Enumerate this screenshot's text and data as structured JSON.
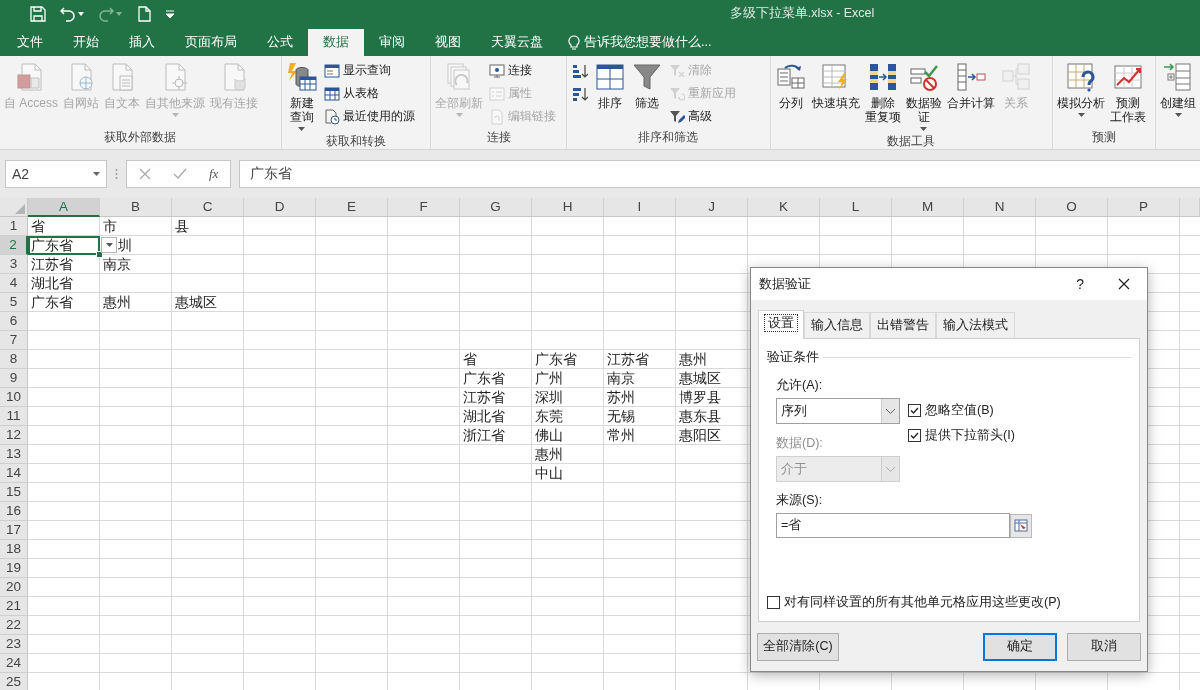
{
  "window": {
    "title": "多级下拉菜单.xlsx - Excel"
  },
  "ribbon_tabs": [
    {
      "label": "文件",
      "selected": false
    },
    {
      "label": "开始",
      "selected": false
    },
    {
      "label": "插入",
      "selected": false
    },
    {
      "label": "页面布局",
      "selected": false
    },
    {
      "label": "公式",
      "selected": false
    },
    {
      "label": "数据",
      "selected": true
    },
    {
      "label": "审阅",
      "selected": false
    },
    {
      "label": "视图",
      "selected": false
    },
    {
      "label": "天翼云盘",
      "selected": false
    }
  ],
  "tell_me": {
    "text": "告诉我您想要做什么..."
  },
  "ribbon": {
    "groups": [
      {
        "label": "获取外部数据",
        "controls": [
          {
            "kind": "large",
            "lines": [
              "自 Access"
            ],
            "disabled": true,
            "caret": false
          },
          {
            "kind": "large",
            "lines": [
              "自网站"
            ],
            "disabled": true,
            "caret": false
          },
          {
            "kind": "large",
            "lines": [
              "自文本"
            ],
            "disabled": true,
            "caret": false
          },
          {
            "kind": "large",
            "lines": [
              "自其他来源"
            ],
            "disabled": true,
            "caret": true
          },
          {
            "kind": "large",
            "lines": [
              "现有连接"
            ],
            "disabled": true,
            "caret": false
          }
        ]
      },
      {
        "label": "获取和转换",
        "controls": [
          {
            "kind": "large",
            "lines": [
              "新建",
              "查询"
            ],
            "disabled": false,
            "caret": true
          },
          {
            "kind": "stack",
            "items": [
              {
                "label": "显示查询",
                "disabled": false
              },
              {
                "label": "从表格",
                "disabled": false
              },
              {
                "label": "最近使用的源",
                "disabled": false
              }
            ]
          }
        ]
      },
      {
        "label": "连接",
        "controls": [
          {
            "kind": "large",
            "lines": [
              "全部刷新"
            ],
            "disabled": true,
            "caret": true
          },
          {
            "kind": "stack",
            "items": [
              {
                "label": "连接",
                "disabled": false
              },
              {
                "label": "属性",
                "disabled": true
              },
              {
                "label": "编辑链接",
                "disabled": true
              }
            ]
          }
        ]
      },
      {
        "label": "排序和筛选",
        "controls": [
          {
            "kind": "stack",
            "items": [
              {
                "disabled": false
              },
              {
                "disabled": false
              }
            ]
          },
          {
            "kind": "large",
            "lines": [
              "排序"
            ],
            "disabled": false,
            "caret": false
          },
          {
            "kind": "large",
            "lines": [
              "筛选"
            ],
            "disabled": false,
            "caret": false
          },
          {
            "kind": "stack",
            "items": [
              {
                "label": "清除",
                "disabled": true
              },
              {
                "label": "重新应用",
                "disabled": true
              },
              {
                "label": "高级",
                "disabled": false
              }
            ]
          }
        ]
      },
      {
        "label": "数据工具",
        "controls": [
          {
            "kind": "large",
            "lines": [
              "分列"
            ],
            "disabled": false,
            "caret": false
          },
          {
            "kind": "large",
            "lines": [
              "快速填充"
            ],
            "disabled": false,
            "caret": false
          },
          {
            "kind": "large",
            "lines": [
              "删除",
              "重复项"
            ],
            "disabled": false,
            "caret": false
          },
          {
            "kind": "large",
            "lines": [
              "数据验",
              "证"
            ],
            "disabled": false,
            "caret": true
          },
          {
            "kind": "large",
            "lines": [
              "合并计算"
            ],
            "disabled": false,
            "caret": false
          },
          {
            "kind": "large",
            "lines": [
              "关系"
            ],
            "disabled": true,
            "caret": false
          }
        ]
      },
      {
        "label": "预测",
        "controls": [
          {
            "kind": "large",
            "lines": [
              "模拟分析"
            ],
            "disabled": false,
            "caret": true
          },
          {
            "kind": "large",
            "lines": [
              "预测",
              "工作表"
            ],
            "disabled": false,
            "caret": false
          }
        ]
      },
      {
        "controls": [
          {
            "kind": "large",
            "lines": [
              "创建组"
            ],
            "disabled": false,
            "caret": true
          }
        ]
      }
    ]
  },
  "formula_bar": {
    "name_box": "A2",
    "function_label": "fx",
    "value": "广东省"
  },
  "sheet": {
    "columns": [
      "A",
      "B",
      "C",
      "D",
      "E",
      "F",
      "G",
      "H",
      "I",
      "J",
      "K",
      "L",
      "M",
      "N",
      "O",
      "P"
    ],
    "rows": [
      {
        "number": "1",
        "cells": [
          {
            "text": "省",
            "selected": false,
            "dropdown": false
          },
          {
            "text": "市",
            "selected": false,
            "dropdown": false
          },
          {
            "text": "县",
            "selected": false,
            "dropdown": false
          }
        ]
      },
      {
        "number": "2",
        "cells": [
          {
            "text": "广东省",
            "selected": true,
            "dropdown": true
          },
          {
            "text": "圳",
            "selected": false,
            "dropdown": false
          }
        ]
      },
      {
        "number": "3",
        "cells": [
          {
            "text": "江苏省",
            "selected": false,
            "dropdown": false
          },
          {
            "text": "南京",
            "selected": false,
            "dropdown": false
          }
        ]
      },
      {
        "number": "4",
        "cells": [
          {
            "text": "湖北省",
            "selected": false,
            "dropdown": false
          }
        ]
      },
      {
        "number": "5",
        "cells": [
          {
            "text": "广东省",
            "selected": false,
            "dropdown": false
          },
          {
            "text": "惠州",
            "selected": false,
            "dropdown": false
          },
          {
            "text": "惠城区",
            "selected": false,
            "dropdown": false
          }
        ]
      },
      {
        "number": "6"
      },
      {
        "number": "7"
      },
      {
        "number": "8",
        "cells": [
          null,
          null,
          null,
          null,
          null,
          null,
          {
            "text": "省",
            "selected": false,
            "dropdown": false
          },
          {
            "text": "广东省",
            "selected": false,
            "dropdown": false
          },
          {
            "text": "江苏省",
            "selected": false,
            "dropdown": false
          },
          {
            "text": "惠州",
            "selected": false,
            "dropdown": false
          }
        ]
      },
      {
        "number": "9",
        "cells": [
          null,
          null,
          null,
          null,
          null,
          null,
          {
            "text": "广东省",
            "selected": false,
            "dropdown": false
          },
          {
            "text": "广州",
            "selected": false,
            "dropdown": false
          },
          {
            "text": "南京",
            "selected": false,
            "dropdown": false
          },
          {
            "text": "惠城区",
            "selected": false,
            "dropdown": false
          }
        ]
      },
      {
        "number": "10",
        "cells": [
          null,
          null,
          null,
          null,
          null,
          null,
          {
            "text": "江苏省",
            "selected": false,
            "dropdown": false
          },
          {
            "text": "深圳",
            "selected": false,
            "dropdown": false
          },
          {
            "text": "苏州",
            "selected": false,
            "dropdown": false
          },
          {
            "text": "博罗县",
            "selected": false,
            "dropdown": false
          }
        ]
      },
      {
        "number": "11",
        "cells": [
          null,
          null,
          null,
          null,
          null,
          null,
          {
            "text": "湖北省",
            "selected": false,
            "dropdown": false
          },
          {
            "text": "东莞",
            "selected": false,
            "dropdown": false
          },
          {
            "text": "无锡",
            "selected": false,
            "dropdown": false
          },
          {
            "text": "惠东县",
            "selected": false,
            "dropdown": false
          }
        ]
      },
      {
        "number": "12",
        "cells": [
          null,
          null,
          null,
          null,
          null,
          null,
          {
            "text": "浙江省",
            "selected": false,
            "dropdown": false
          },
          {
            "text": "佛山",
            "selected": false,
            "dropdown": false
          },
          {
            "text": "常州",
            "selected": false,
            "dropdown": false
          },
          {
            "text": "惠阳区",
            "selected": false,
            "dropdown": false
          }
        ]
      },
      {
        "number": "13",
        "cells": [
          null,
          null,
          null,
          null,
          null,
          null,
          null,
          {
            "text": "惠州",
            "selected": false,
            "dropdown": false
          }
        ]
      },
      {
        "number": "14",
        "cells": [
          null,
          null,
          null,
          null,
          null,
          null,
          null,
          {
            "text": "中山",
            "selected": false,
            "dropdown": false
          }
        ]
      },
      {
        "number": "15"
      },
      {
        "number": "16"
      },
      {
        "number": "17"
      },
      {
        "number": "18"
      },
      {
        "number": "19"
      },
      {
        "number": "20"
      },
      {
        "number": "21"
      },
      {
        "number": "22"
      },
      {
        "number": "23"
      },
      {
        "number": "24"
      },
      {
        "number": "25"
      }
    ]
  },
  "dialog": {
    "title": "数据验证",
    "help": "?",
    "tabs": [
      {
        "label": "设置",
        "selected": true
      },
      {
        "label": "输入信息",
        "selected": false
      },
      {
        "label": "出错警告",
        "selected": false
      },
      {
        "label": "输入法模式",
        "selected": false
      }
    ],
    "section": "验证条件",
    "allow": {
      "label": "允许(A):",
      "value": "序列",
      "disabled": false
    },
    "data": {
      "label": "数据(D):",
      "value": "介于",
      "disabled": true
    },
    "options": [
      {
        "label": "忽略空值(B)",
        "checked": true
      },
      {
        "label": "提供下拉箭头(I)",
        "checked": true
      }
    ],
    "source": {
      "label": "来源(S):",
      "value": "=省"
    },
    "apply_all": {
      "label": "对有同样设置的所有其他单元格应用这些更改(P)",
      "checked": false
    },
    "buttons": [
      {
        "label": "全部清除(C)",
        "default": false
      },
      {
        "label": "确定",
        "default": true
      },
      {
        "label": "取消",
        "default": false
      }
    ]
  }
}
